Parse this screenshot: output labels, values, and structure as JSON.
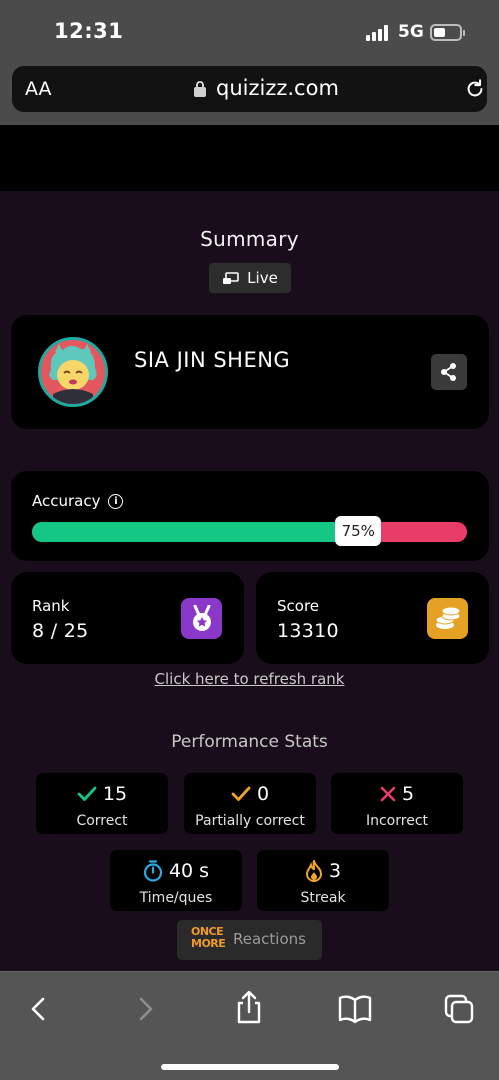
{
  "status": {
    "time": "12:31",
    "network": "5G"
  },
  "browser": {
    "text_size_label": "AA",
    "domain": "quizizz.com"
  },
  "summary": {
    "title": "Summary",
    "mode_label": "Live",
    "player_name": "SIA JIN SHENG",
    "accuracy": {
      "label": "Accuracy",
      "percent": 75,
      "percent_label": "75%"
    },
    "rank": {
      "label": "Rank",
      "value": "8 / 25"
    },
    "score": {
      "label": "Score",
      "value": "13310"
    },
    "refresh_link": "Click here to refresh rank"
  },
  "performance": {
    "title": "Performance Stats",
    "correct": {
      "value": "15",
      "label": "Correct"
    },
    "partial": {
      "value": "0",
      "label": "Partially correct"
    },
    "incorrect": {
      "value": "5",
      "label": "Incorrect"
    },
    "time_per_question": {
      "value": "40 s",
      "label": "Time/ques"
    },
    "streak": {
      "value": "3",
      "label": "Streak"
    }
  },
  "reactions": {
    "logo_text": "ONCE MORE",
    "label": "Reactions"
  },
  "colors": {
    "accuracy_correct": "#14c784",
    "accuracy_incorrect": "#ea3c68",
    "rank_icon_bg": "#8a38c9",
    "score_icon_bg": "#e4a124",
    "correct_check": "#14c784",
    "partial_check": "#f0a52a",
    "incorrect_cross": "#ea3c68",
    "timer_icon": "#2ea8e0",
    "streak_icon": "#f0a52a"
  }
}
